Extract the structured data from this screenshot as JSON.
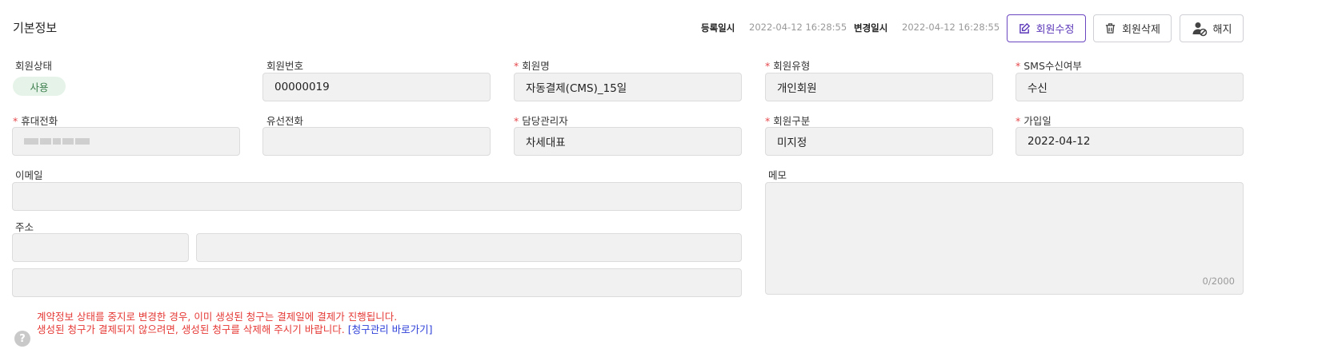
{
  "section": {
    "title": "기본정보"
  },
  "meta": {
    "registered_label": "등록일시",
    "registered_value": "2022-04-12 16:28:55",
    "modified_label": "변경일시",
    "modified_value": "2022-04-12 16:28:55"
  },
  "buttons": {
    "edit": "회원수정",
    "delete": "회원삭제",
    "cancel": "해지"
  },
  "fields": {
    "status": {
      "label": "회원상태",
      "value": "사용"
    },
    "member_no": {
      "label": "회원번호",
      "value": "00000019"
    },
    "member_name": {
      "label": "회원명",
      "value": "자동결제(CMS)_15일",
      "required": "*"
    },
    "member_type": {
      "label": "회원유형",
      "value": "개인회원",
      "required": "*"
    },
    "sms": {
      "label": "SMS수신여부",
      "value": "수신",
      "required": "*"
    },
    "mobile": {
      "label": "휴대전화",
      "value": "",
      "required": "*"
    },
    "landline": {
      "label": "유선전화",
      "value": ""
    },
    "manager": {
      "label": "담당관리자",
      "value": "차세대표",
      "required": "*"
    },
    "category": {
      "label": "회원구분",
      "value": "미지정",
      "required": "*"
    },
    "join_date": {
      "label": "가입일",
      "value": "2022-04-12",
      "required": "*"
    },
    "email": {
      "label": "이메일",
      "value": ""
    },
    "memo": {
      "label": "메모",
      "counter": "0/2000"
    },
    "address": {
      "label": "주소"
    }
  },
  "notice": {
    "line1": "계약정보 상태를 중지로 변경한 경우, 이미 생성된 청구는 결제일에 결제가 진행됩니다.",
    "line2": "생성된 청구가 결제되지 않으려면, 생성된 청구를 삭제해 주시기 바랍니다.",
    "link": "[청구관리 바로가기]"
  },
  "colors": {
    "accent": "#5a36b8",
    "required": "#e5484d",
    "badge_bg": "#e5f3e8",
    "badge_text": "#3d7f4e",
    "notice": "#e53935",
    "link": "#2d3fd8"
  }
}
